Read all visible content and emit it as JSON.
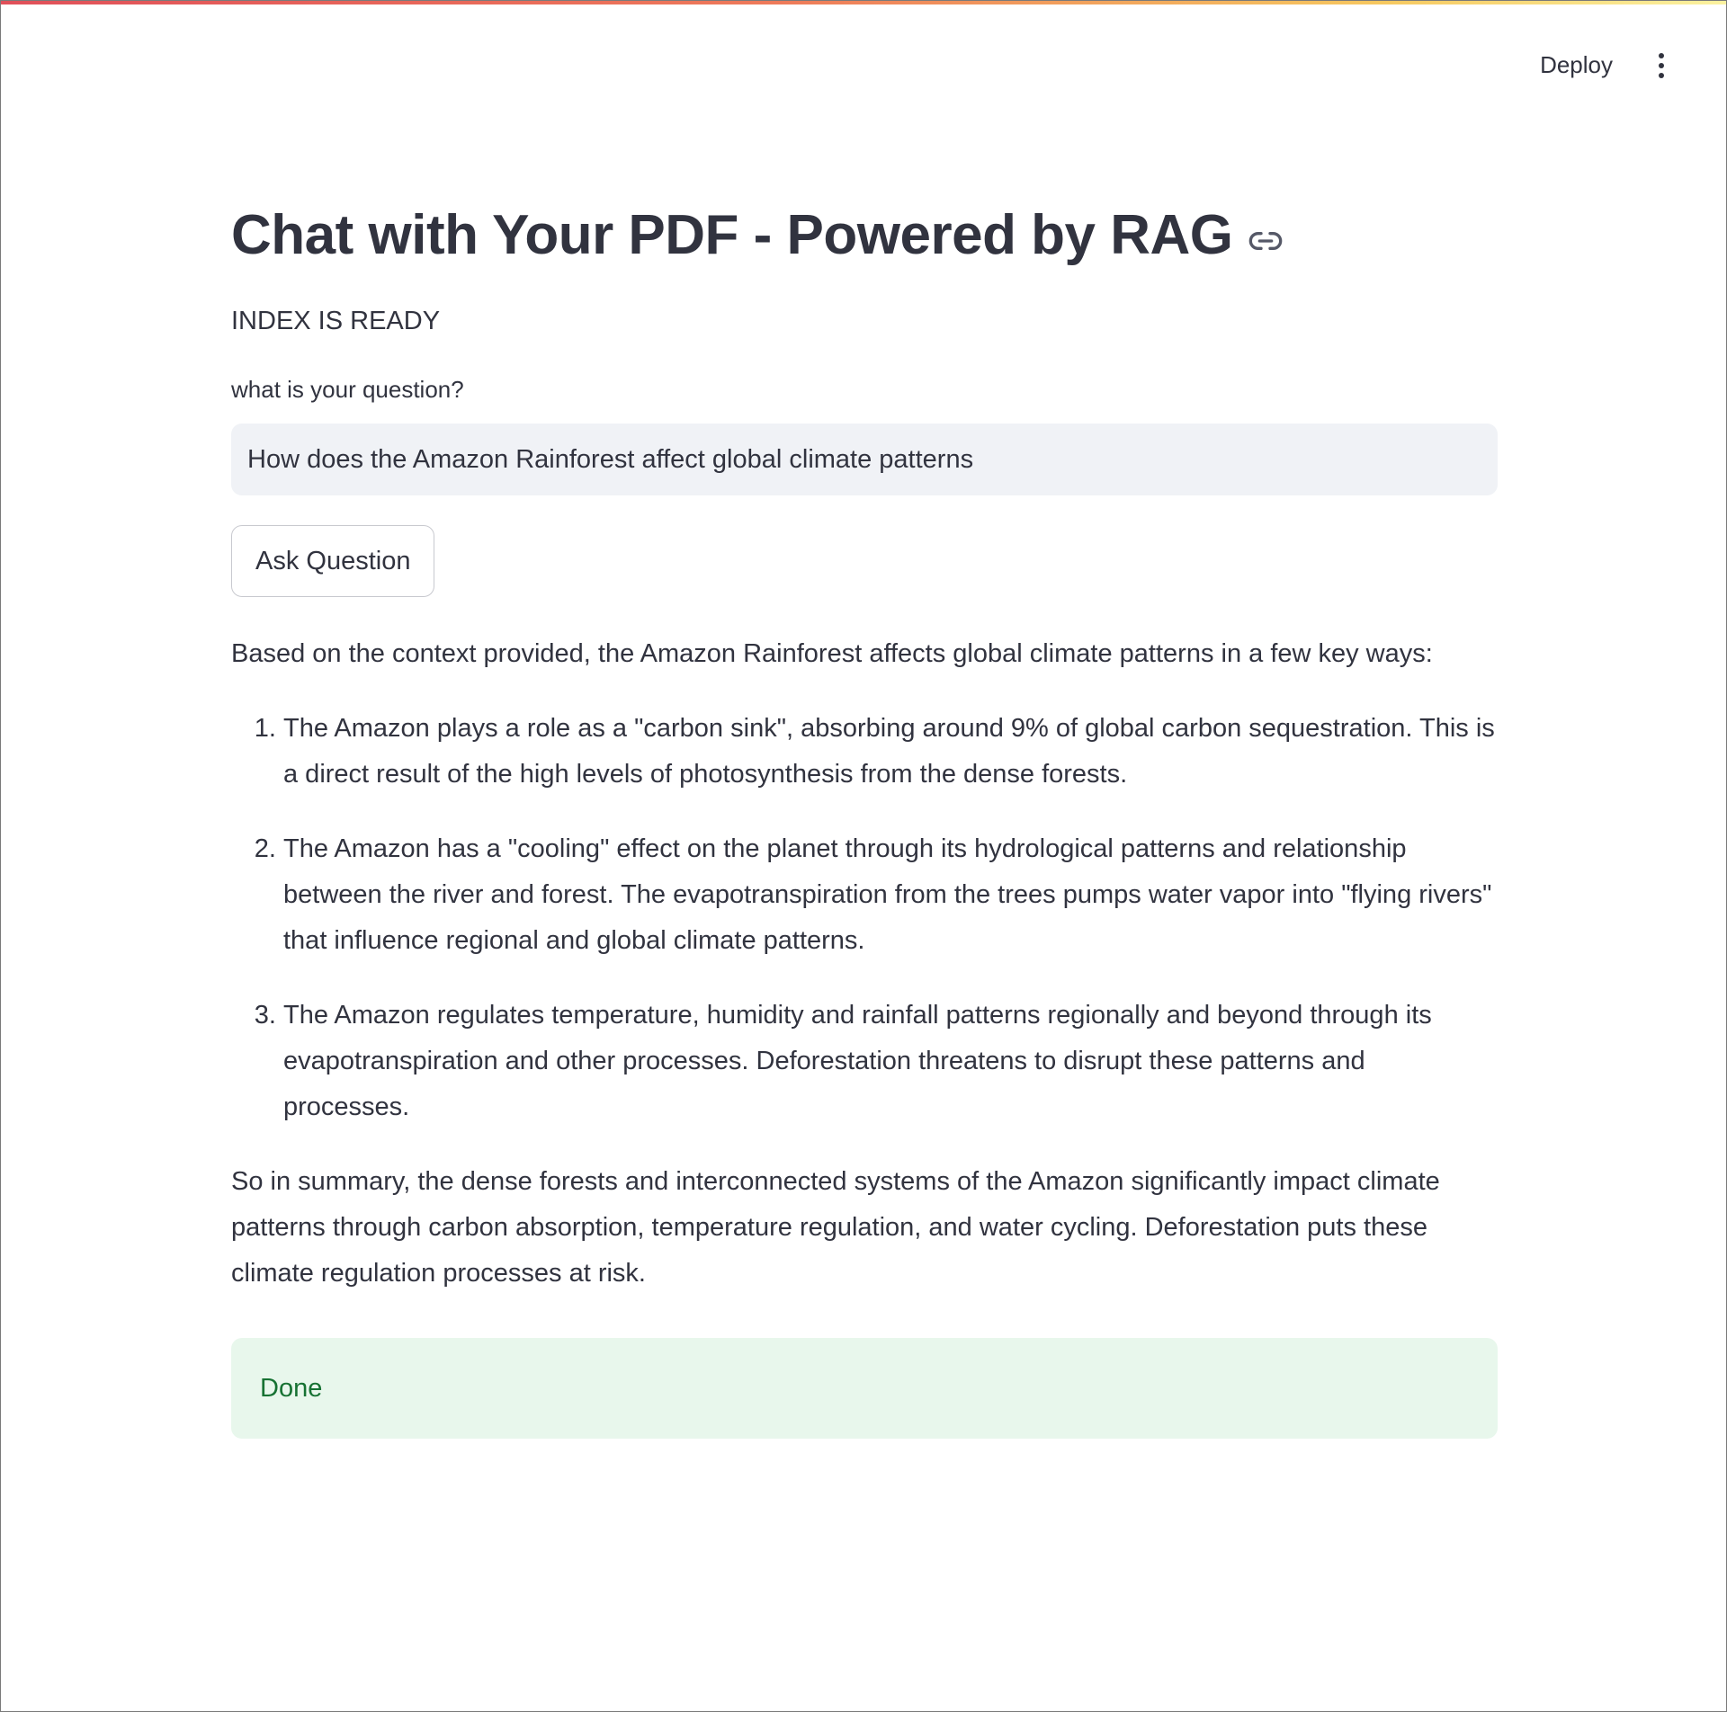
{
  "header": {
    "deploy_label": "Deploy",
    "menu_icon": "vertical-ellipsis-icon"
  },
  "main": {
    "title": "Chat with Your PDF - Powered by RAG",
    "title_link_icon": "link-icon",
    "status": "INDEX IS READY",
    "question_label": "what is your question?",
    "question_value": "How does the Amazon Rainforest affect global climate patterns",
    "ask_button_label": "Ask Question"
  },
  "answer": {
    "intro": "Based on the context provided, the Amazon Rainforest affects global climate patterns in a few key ways:",
    "points": [
      "The Amazon plays a role as a \"carbon sink\", absorbing around 9% of global carbon sequestration. This is a direct result of the high levels of photosynthesis from the dense forests.",
      "The Amazon has a \"cooling\" effect on the planet through its hydrological patterns and relationship between the river and forest. The evapotranspiration from the trees pumps water vapor into \"flying rivers\" that influence regional and global climate patterns.",
      "The Amazon regulates temperature, humidity and rainfall patterns regionally and beyond through its evapotranspiration and other processes. Deforestation threatens to disrupt these patterns and processes."
    ],
    "summary": "So in summary, the dense forests and interconnected systems of the Amazon significantly impact climate patterns through carbon absorption, temperature regulation, and water cycling. Deforestation puts these climate regulation processes at risk."
  },
  "status_box": {
    "message": "Done",
    "background": "#e8f7ec",
    "text_color": "#177233"
  }
}
